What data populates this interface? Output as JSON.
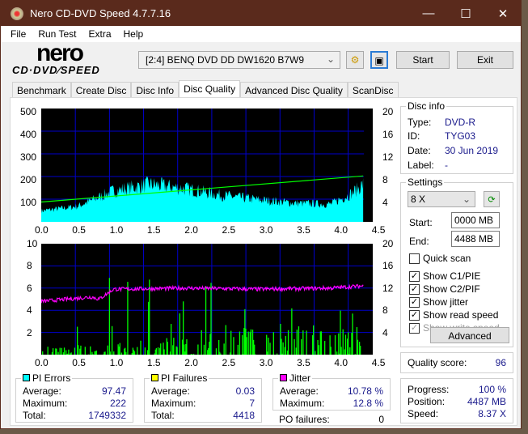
{
  "window": {
    "title": "Nero CD-DVD Speed 4.7.7.16",
    "minimize": "—",
    "maximize": "☐",
    "close": "✕"
  },
  "menu": [
    "File",
    "Run Test",
    "Extra",
    "Help"
  ],
  "logo": {
    "top": "nero",
    "bottom": "CD·DVD⁄SPEED"
  },
  "toolbar": {
    "drive": "[2:4]   BENQ DVD DD DW1620 B7W9",
    "start": "Start",
    "exit": "Exit"
  },
  "tabs": [
    "Benchmark",
    "Create Disc",
    "Disc Info",
    "Disc Quality",
    "Advanced Disc Quality",
    "ScanDisc"
  ],
  "active_tab": "Disc Quality",
  "disc_info": {
    "title": "Disc info",
    "type_label": "Type:",
    "type": "DVD-R",
    "id_label": "ID:",
    "id": "TYG03",
    "date_label": "Date:",
    "date": "30 Jun 2019",
    "label_label": "Label:",
    "label": "-"
  },
  "settings": {
    "title": "Settings",
    "speed": "8 X",
    "start_label": "Start:",
    "start": "0000 MB",
    "end_label": "End:",
    "end": "4488 MB",
    "checks": [
      {
        "label": "Quick scan",
        "checked": false
      },
      {
        "label": "Show C1/PIE",
        "checked": true
      },
      {
        "label": "Show C2/PIF",
        "checked": true
      },
      {
        "label": "Show jitter",
        "checked": true
      },
      {
        "label": "Show read speed",
        "checked": true
      },
      {
        "label": "Show write speed",
        "checked": true,
        "disabled": true
      }
    ],
    "advanced": "Advanced"
  },
  "quality": {
    "label": "Quality score:",
    "value": "96"
  },
  "progress": {
    "progress_label": "Progress:",
    "progress": "100 %",
    "position_label": "Position:",
    "position": "4487 MB",
    "speed_label": "Speed:",
    "speed": "8.37 X"
  },
  "pi_errors": {
    "title": "PI Errors",
    "color": "#00ffff",
    "average_label": "Average:",
    "average": "97.47",
    "maximum_label": "Maximum:",
    "maximum": "222",
    "total_label": "Total:",
    "total": "1749332"
  },
  "pi_failures": {
    "title": "PI Failures",
    "color": "#ffff00",
    "average_label": "Average:",
    "average": "0.03",
    "maximum_label": "Maximum:",
    "maximum": "7",
    "total_label": "Total:",
    "total": "4418"
  },
  "jitter": {
    "title": "Jitter",
    "color": "#ff00ff",
    "average_label": "Average:",
    "average": "10.78 %",
    "maximum_label": "Maximum:",
    "maximum": "12.8 %",
    "po_label": "PO failures:",
    "po": "0"
  },
  "chart_data": [
    {
      "type": "area",
      "series": [
        {
          "values_profile_x": [
            0,
            0.5,
            1.0,
            1.5,
            2.0,
            2.5,
            3.0,
            3.5,
            4.0,
            4.3,
            4.45
          ],
          "values_profile_y": [
            50,
            70,
            140,
            170,
            150,
            120,
            100,
            85,
            80,
            130,
            170
          ],
          "color": "#00ffff"
        },
        {
          "type": "line",
          "color": "#00ff00",
          "x": [
            0,
            4.45
          ],
          "y": [
            3.5,
            8.1
          ],
          "axis": "right"
        }
      ],
      "xlim": [
        0,
        4.5
      ],
      "ylim_left": [
        0,
        500
      ],
      "ylim_right": [
        0,
        20
      ],
      "x_ticks": [
        "0.0",
        "0.5",
        "1.0",
        "1.5",
        "2.0",
        "2.5",
        "3.0",
        "3.5",
        "4.0",
        "4.5"
      ],
      "y_left_ticks": [
        "500",
        "400",
        "300",
        "200",
        "100"
      ],
      "y_right_ticks": [
        "20",
        "16",
        "12",
        "8",
        "4"
      ],
      "grid": true
    },
    {
      "type": "bar",
      "series": [
        {
          "color": "#00ff00",
          "note_profile_x": [
            0,
            1.0,
            3.5,
            4.0,
            4.45
          ],
          "note_profile_y": [
            1,
            1,
            3,
            2,
            3
          ]
        },
        {
          "type": "line",
          "color": "#ff00ff",
          "x": [
            0,
            0.7,
            0.8,
            1.0,
            2.0,
            3.0,
            4.0,
            4.45
          ],
          "y": [
            4.8,
            5.2,
            5.0,
            5.9,
            6.0,
            5.9,
            6.0,
            6.2
          ]
        }
      ],
      "xlim": [
        0,
        4.5
      ],
      "ylim_left": [
        0,
        10
      ],
      "ylim_right": [
        0,
        20
      ],
      "x_ticks": [
        "0.0",
        "0.5",
        "1.0",
        "1.5",
        "2.0",
        "2.5",
        "3.0",
        "3.5",
        "4.0",
        "4.5"
      ],
      "y_left_ticks": [
        "10",
        "8",
        "6",
        "4",
        "2"
      ],
      "y_right_ticks": [
        "20",
        "16",
        "12",
        "8",
        "4"
      ],
      "grid": true
    }
  ]
}
